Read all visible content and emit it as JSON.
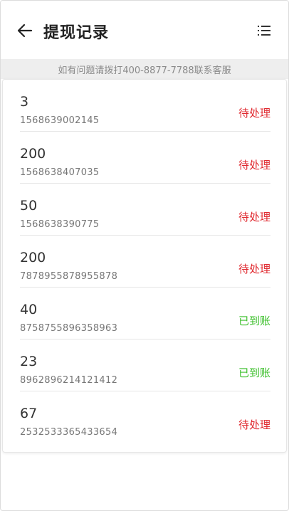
{
  "header": {
    "title": "提现记录",
    "back_icon": "arrow-left-icon",
    "menu_icon": "list-icon"
  },
  "notice": "如有问题请拨打400-8877-7788联系客服",
  "colors": {
    "pending": "#e0292f",
    "arrived": "#3bbf2a"
  },
  "records": [
    {
      "amount": "3",
      "order_no": "1568639002145",
      "status": "待处理",
      "state": "pending"
    },
    {
      "amount": "200",
      "order_no": "1568638407035",
      "status": "待处理",
      "state": "pending"
    },
    {
      "amount": "50",
      "order_no": "1568638390775",
      "status": "待处理",
      "state": "pending"
    },
    {
      "amount": "200",
      "order_no": "7878955878955878",
      "status": "待处理",
      "state": "pending"
    },
    {
      "amount": "40",
      "order_no": "8758755896358963",
      "status": "已到账",
      "state": "arrived"
    },
    {
      "amount": "23",
      "order_no": "8962896214121412",
      "status": "已到账",
      "state": "arrived"
    },
    {
      "amount": "67",
      "order_no": "2532533365433654",
      "status": "待处理",
      "state": "pending"
    }
  ]
}
